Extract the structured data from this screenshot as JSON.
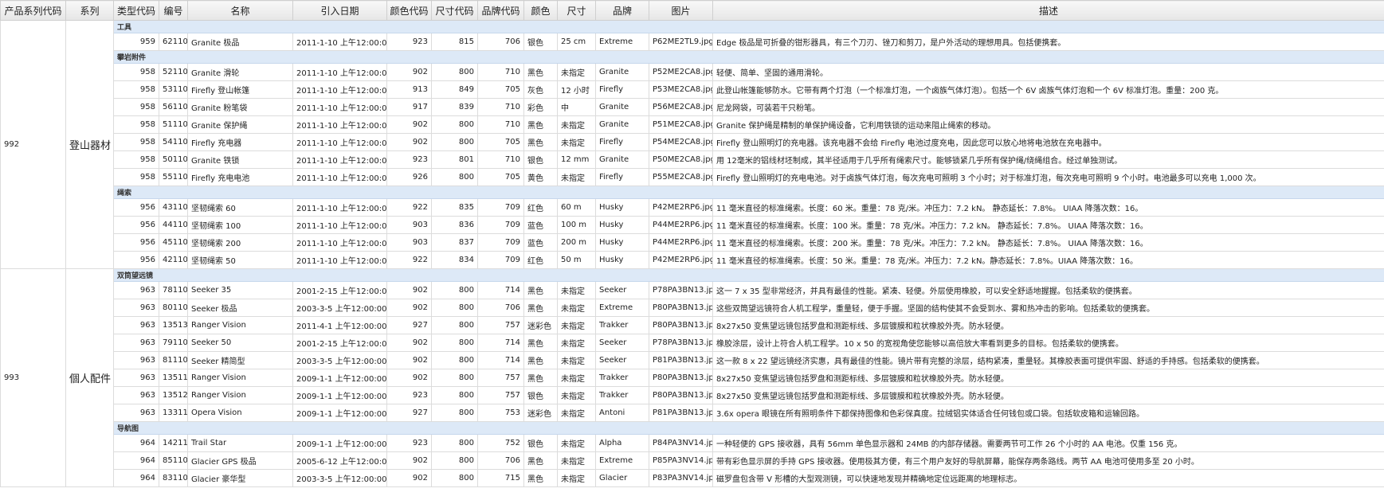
{
  "columns": [
    "产品系列代码",
    "系列",
    "类型代码",
    "编号",
    "名称",
    "引入日期",
    "颜色代码",
    "尺寸代码",
    "品牌代码",
    "颜色",
    "尺寸",
    "品牌",
    "图片",
    "描述"
  ],
  "families": [
    {
      "code": "992",
      "name": "登山器材",
      "groups": [
        {
          "label": "工具",
          "rows": [
            [
              "959",
              "62110",
              "Granite 极品",
              "2011-1-10 上午12:00:00",
              "923",
              "815",
              "706",
              "银色",
              "25 cm",
              "Extreme",
              "P62ME2TL9.jpg",
              "Edge 极品是可折叠的钳形器具，有三个刀刃、锉刀和剪刀，是户外活动的理想用具。包括便携套。"
            ]
          ]
        },
        {
          "label": "攀岩附件",
          "rows": [
            [
              "958",
              "52110",
              "Granite 滑轮",
              "2011-1-10 上午12:00:00",
              "902",
              "800",
              "710",
              "黑色",
              "未指定",
              "Granite",
              "P52ME2CA8.jpg",
              "轻便、简单、坚固的通用滑轮。"
            ],
            [
              "958",
              "53110",
              "Firefly 登山帐篷",
              "2011-1-10 上午12:00:00",
              "913",
              "849",
              "705",
              "灰色",
              "12 小时",
              "Firefly",
              "P53ME2CA8.jpg",
              "此登山帐篷能够防水。它带有两个灯泡（一个标准灯泡，一个卤族气体灯泡）。包括一个 6V 卤族气体灯泡和一个 6V 标准灯泡。重量：200 克。"
            ],
            [
              "958",
              "56110",
              "Granite 粉笔袋",
              "2011-1-10 上午12:00:00",
              "917",
              "839",
              "710",
              "彩色",
              "中",
              "Granite",
              "P56ME2CA8.jpg",
              "尼龙网袋，可装若干只粉笔。"
            ],
            [
              "958",
              "51110",
              "Granite 保护绳",
              "2011-1-10 上午12:00:00",
              "902",
              "800",
              "710",
              "黑色",
              "未指定",
              "Granite",
              "P51ME2CA8.jpg",
              "Granite 保护绳是精制的单保护绳设备，它利用铁锁的运动来阻止绳索的移动。"
            ],
            [
              "958",
              "54110",
              "Firefly 充电器",
              "2011-1-10 上午12:00:00",
              "902",
              "800",
              "705",
              "黑色",
              "未指定",
              "Firefly",
              "P54ME2CA8.jpg",
              "Firefly 登山照明灯的充电器。该充电器不会给 Firefly 电池过度充电，因此您可以放心地将电池放在充电器中。"
            ],
            [
              "958",
              "50110",
              "Granite 铁锁",
              "2011-1-10 上午12:00:00",
              "923",
              "801",
              "710",
              "银色",
              "12 mm",
              "Granite",
              "P50ME2CA8.jpg",
              "用 12毫米的铝线材坯制成，其半径适用于几乎所有绳索尺寸。能够锁紧几乎所有保护绳/绕绳组合。经过单独测试。"
            ],
            [
              "958",
              "55110",
              "Firefly 充电电池",
              "2011-1-10 上午12:00:00",
              "926",
              "800",
              "705",
              "黄色",
              "未指定",
              "Firefly",
              "P55ME2CA8.jpg",
              "Firefly 登山照明灯的充电电池。对于卤族气体灯泡，每次充电可照明 3 个小时；对于标准灯泡，每次充电可照明 9 个小时。电池最多可以充电 1,000 次。"
            ]
          ]
        },
        {
          "label": "绳索",
          "rows": [
            [
              "956",
              "43110",
              "坚韧绳索 60",
              "2011-1-10 上午12:00:00",
              "922",
              "835",
              "709",
              "红色",
              "60 m",
              "Husky",
              "P42ME2RP6.jpg",
              "11 毫米直径的标准绳索。长度：60 米。重量：78 克/米。冲压力：7.2 kN。 静态延长：7.8%。 UIAA 降落次数：16。"
            ],
            [
              "956",
              "44110",
              "坚韧绳索 100",
              "2011-1-10 上午12:00:00",
              "903",
              "836",
              "709",
              "蓝色",
              "100 m",
              "Husky",
              "P44ME2RP6.jpg",
              "11 毫米直径的标准绳索。长度：100 米。重量：78 克/米。冲压力：7.2 kN。 静态延长：7.8%。 UIAA 降落次数：16。"
            ],
            [
              "956",
              "45110",
              "坚韧绳索 200",
              "2011-1-10 上午12:00:00",
              "903",
              "837",
              "709",
              "蓝色",
              "200 m",
              "Husky",
              "P44ME2RP6.jpg",
              "11 毫米直径的标准绳索。长度：200 米。重量：78 克/米。冲压力：7.2 kN。 静态延长：7.8%。 UIAA 降落次数：16。"
            ],
            [
              "956",
              "42110",
              "坚韧绳索 50",
              "2011-1-10 上午12:00:00",
              "922",
              "834",
              "709",
              "红色",
              "50 m",
              "Husky",
              "P42ME2RP6.jpg",
              "11 毫米直径的标准绳索。长度：50 米。重量：78 克/米。冲压力：7.2 kN。静态延长：7.8%。UIAA 降落次数：16。"
            ]
          ]
        }
      ]
    },
    {
      "code": "993",
      "name": "個人配件",
      "groups": [
        {
          "label": "双筒望远镜",
          "rows": [
            [
              "963",
              "78110",
              "Seeker 35",
              "2001-2-15 上午12:00:00",
              "902",
              "800",
              "714",
              "黑色",
              "未指定",
              "Seeker",
              "P78PA3BN13.jpg",
              "这一 7 x 35 型非常经济，并具有最佳的性能。紧凑、轻便。外层使用橡胶，可以安全舒适地握握。包括柔软的便携套。"
            ],
            [
              "963",
              "80110",
              "Seeker 极品",
              "2003-3-5 上午12:00:00",
              "902",
              "800",
              "706",
              "黑色",
              "未指定",
              "Extreme",
              "P80PA3BN13.jpg",
              "这些双筒望远镜符合人机工程学，重量轻，便于手握。坚固的结构使其不会受到水、雾和热冲击的影响。包括柔软的便携套。"
            ],
            [
              "963",
              "135130",
              "Ranger Vision",
              "2011-4-1 上午12:00:00",
              "927",
              "800",
              "757",
              "迷彩色",
              "未指定",
              "Trakker",
              "P80PA3BN13.jpg",
              "8x27x50 变焦望远镜包括罗盘和测距标线、多层镀膜和粒状橡胶外壳。防水轻便。"
            ],
            [
              "963",
              "79110",
              "Seeker 50",
              "2001-2-15 上午12:00:00",
              "902",
              "800",
              "714",
              "黑色",
              "未指定",
              "Seeker",
              "P78PA3BN13.jpg",
              "橡胶涂层，设计上符合人机工程学。10 x 50 的宽视角使您能够以高倍放大率看到更多的目标。包括柔软的便携套。"
            ],
            [
              "963",
              "81110",
              "Seeker 精简型",
              "2003-3-5 上午12:00:00",
              "902",
              "800",
              "714",
              "黑色",
              "未指定",
              "Seeker",
              "P81PA3BN13.jpg",
              "这一款 8 x 22 望远镜经济实惠，具有最佳的性能。镜片带有完整的涂层，结构紧凑，重量轻。其橡胶表面可提供牢固、舒适的手持感。包括柔软的便携套。"
            ],
            [
              "963",
              "135110",
              "Ranger Vision",
              "2009-1-1 上午12:00:00",
              "902",
              "800",
              "757",
              "黑色",
              "未指定",
              "Trakker",
              "P80PA3BN13.jpg",
              "8x27x50 变焦望远镜包括罗盘和测距标线、多层镀膜和粒状橡胶外壳。防水轻便。"
            ],
            [
              "963",
              "135120",
              "Ranger Vision",
              "2009-1-1 上午12:00:00",
              "923",
              "800",
              "757",
              "银色",
              "未指定",
              "Trakker",
              "P80PA3BN13.jpg",
              "8x27x50 变焦望远镜包括罗盘和测距标线、多层镀膜和粒状橡胶外壳。防水轻便。"
            ],
            [
              "963",
              "133110",
              "Opera Vision",
              "2009-1-1 上午12:00:00",
              "927",
              "800",
              "753",
              "迷彩色",
              "未指定",
              "Antoni",
              "P81PA3BN13.jpg",
              "3.6x opera 眼镜在所有照明条件下都保持图像和色彩保真度。拉绒铝实体适合任何钱包或口袋。包括软皮箱和运输回路。"
            ]
          ]
        },
        {
          "label": "导航图",
          "rows": [
            [
              "964",
              "142110",
              "Trail Star",
              "2009-1-1 上午12:00:00",
              "923",
              "800",
              "752",
              "银色",
              "未指定",
              "Alpha",
              "P84PA3NV14.jpg",
              "一种轻便的 GPS 接收器，具有 56mm 单色显示器和 24MB 的内部存储器。需要两节可工作 26 个小时的 AA 电池。仅重 156 克。"
            ],
            [
              "964",
              "85110",
              "Glacier GPS 极品",
              "2005-6-12 上午12:00:00",
              "902",
              "800",
              "706",
              "黑色",
              "未指定",
              "Extreme",
              "P85PA3NV14.jpg",
              "带有彩色显示屏的手持 GPS 接收器。使用极其方便，有三个用户友好的导航屏幕，能保存两条路线。两节 AA 电池可使用多至 20 小时。"
            ],
            [
              "964",
              "83110",
              "Glacier 豪华型",
              "2003-3-5 上午12:00:00",
              "902",
              "800",
              "715",
              "黑色",
              "未指定",
              "Glacier",
              "P83PA3NV14.jpg",
              "磁罗盘包含带 V 形槽的大型观测镜，可以快速地发现并精确地定位远距离的地理标志。"
            ]
          ]
        }
      ]
    }
  ]
}
